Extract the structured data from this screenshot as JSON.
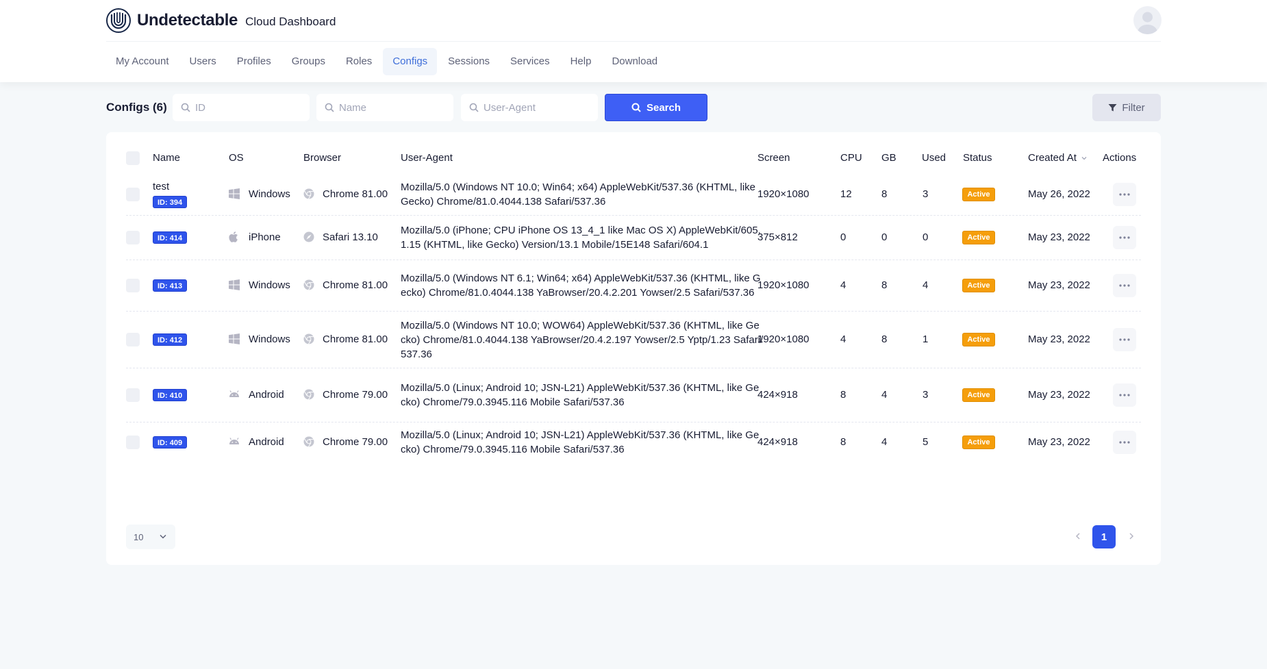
{
  "header": {
    "brand_name": "Undetectable",
    "brand_subtitle": "Cloud Dashboard"
  },
  "nav": [
    {
      "label": "My Account",
      "active": false
    },
    {
      "label": "Users",
      "active": false
    },
    {
      "label": "Profiles",
      "active": false
    },
    {
      "label": "Groups",
      "active": false
    },
    {
      "label": "Roles",
      "active": false
    },
    {
      "label": "Configs",
      "active": true
    },
    {
      "label": "Sessions",
      "active": false
    },
    {
      "label": "Services",
      "active": false
    },
    {
      "label": "Help",
      "active": false
    },
    {
      "label": "Download",
      "active": false
    }
  ],
  "toolbar": {
    "title": "Configs (6)",
    "id_placeholder": "ID",
    "name_placeholder": "Name",
    "ua_placeholder": "User-Agent",
    "search_label": "Search",
    "filter_label": "Filter"
  },
  "table": {
    "columns": [
      "Name",
      "OS",
      "Browser",
      "User-Agent",
      "Screen",
      "CPU",
      "GB",
      "Used",
      "Status",
      "Created At",
      "Actions"
    ],
    "rows": [
      {
        "name": "test",
        "id": "ID: 394",
        "os": "Windows",
        "os_icon": "windows-icon",
        "browser": "Chrome 81.00",
        "browser_icon": "chrome-icon",
        "user_agent": "Mozilla/5.0 (Windows NT 10.0; Win64; x64) AppleWebKit/537.36 (KHTML, like Gecko) Chrome/81.0.4044.138 Safari/537.36",
        "screen": "1920×1080",
        "cpu": "12",
        "gb": "8",
        "used": "3",
        "status": "Active",
        "created": "May 26, 2022"
      },
      {
        "name": "",
        "id": "ID: 414",
        "os": "iPhone",
        "os_icon": "apple-icon",
        "browser": "Safari 13.10",
        "browser_icon": "safari-icon",
        "user_agent": "Mozilla/5.0 (iPhone; CPU iPhone OS 13_4_1 like Mac OS X) AppleWebKit/605.1.15 (KHTML, like Gecko) Version/13.1 Mobile/15E148 Safari/604.1",
        "screen": "375×812",
        "cpu": "0",
        "gb": "0",
        "used": "0",
        "status": "Active",
        "created": "May 23, 2022"
      },
      {
        "name": "",
        "id": "ID: 413",
        "os": "Windows",
        "os_icon": "windows-icon",
        "browser": "Chrome 81.00",
        "browser_icon": "chrome-icon",
        "user_agent": "Mozilla/5.0 (Windows NT 6.1; Win64; x64) AppleWebKit/537.36 (KHTML, like Gecko) Chrome/81.0.4044.138 YaBrowser/20.4.2.201 Yowser/2.5 Safari/537.36",
        "screen": "1920×1080",
        "cpu": "4",
        "gb": "8",
        "used": "4",
        "status": "Active",
        "created": "May 23, 2022"
      },
      {
        "name": "",
        "id": "ID: 412",
        "os": "Windows",
        "os_icon": "windows-icon",
        "browser": "Chrome 81.00",
        "browser_icon": "chrome-icon",
        "user_agent": "Mozilla/5.0 (Windows NT 10.0; WOW64) AppleWebKit/537.36 (KHTML, like Gecko) Chrome/81.0.4044.138 YaBrowser/20.4.2.197 Yowser/2.5 Yptp/1.23 Safari/537.36",
        "screen": "1920×1080",
        "cpu": "4",
        "gb": "8",
        "used": "1",
        "status": "Active",
        "created": "May 23, 2022"
      },
      {
        "name": "",
        "id": "ID: 410",
        "os": "Android",
        "os_icon": "android-icon",
        "browser": "Chrome 79.00",
        "browser_icon": "chrome-icon",
        "user_agent": "Mozilla/5.0 (Linux; Android 10; JSN-L21) AppleWebKit/537.36 (KHTML, like Gecko) Chrome/79.0.3945.116 Mobile Safari/537.36",
        "screen": "424×918",
        "cpu": "8",
        "gb": "4",
        "used": "3",
        "status": "Active",
        "created": "May 23, 2022"
      },
      {
        "name": "",
        "id": "ID: 409",
        "os": "Android",
        "os_icon": "android-icon",
        "browser": "Chrome 79.00",
        "browser_icon": "chrome-icon",
        "user_agent": "Mozilla/5.0 (Linux; Android 10; JSN-L21) AppleWebKit/537.36 (KHTML, like Gecko) Chrome/79.0.3945.116 Mobile Safari/537.36",
        "screen": "424×918",
        "cpu": "8",
        "gb": "4",
        "used": "5",
        "status": "Active",
        "created": "May 23, 2022"
      }
    ]
  },
  "pagination": {
    "page_size": "10",
    "current_page": "1"
  },
  "colors": {
    "primary": "#2f54eb",
    "status_active": "#f59e0b",
    "nav_active": "#3e6ed9"
  }
}
